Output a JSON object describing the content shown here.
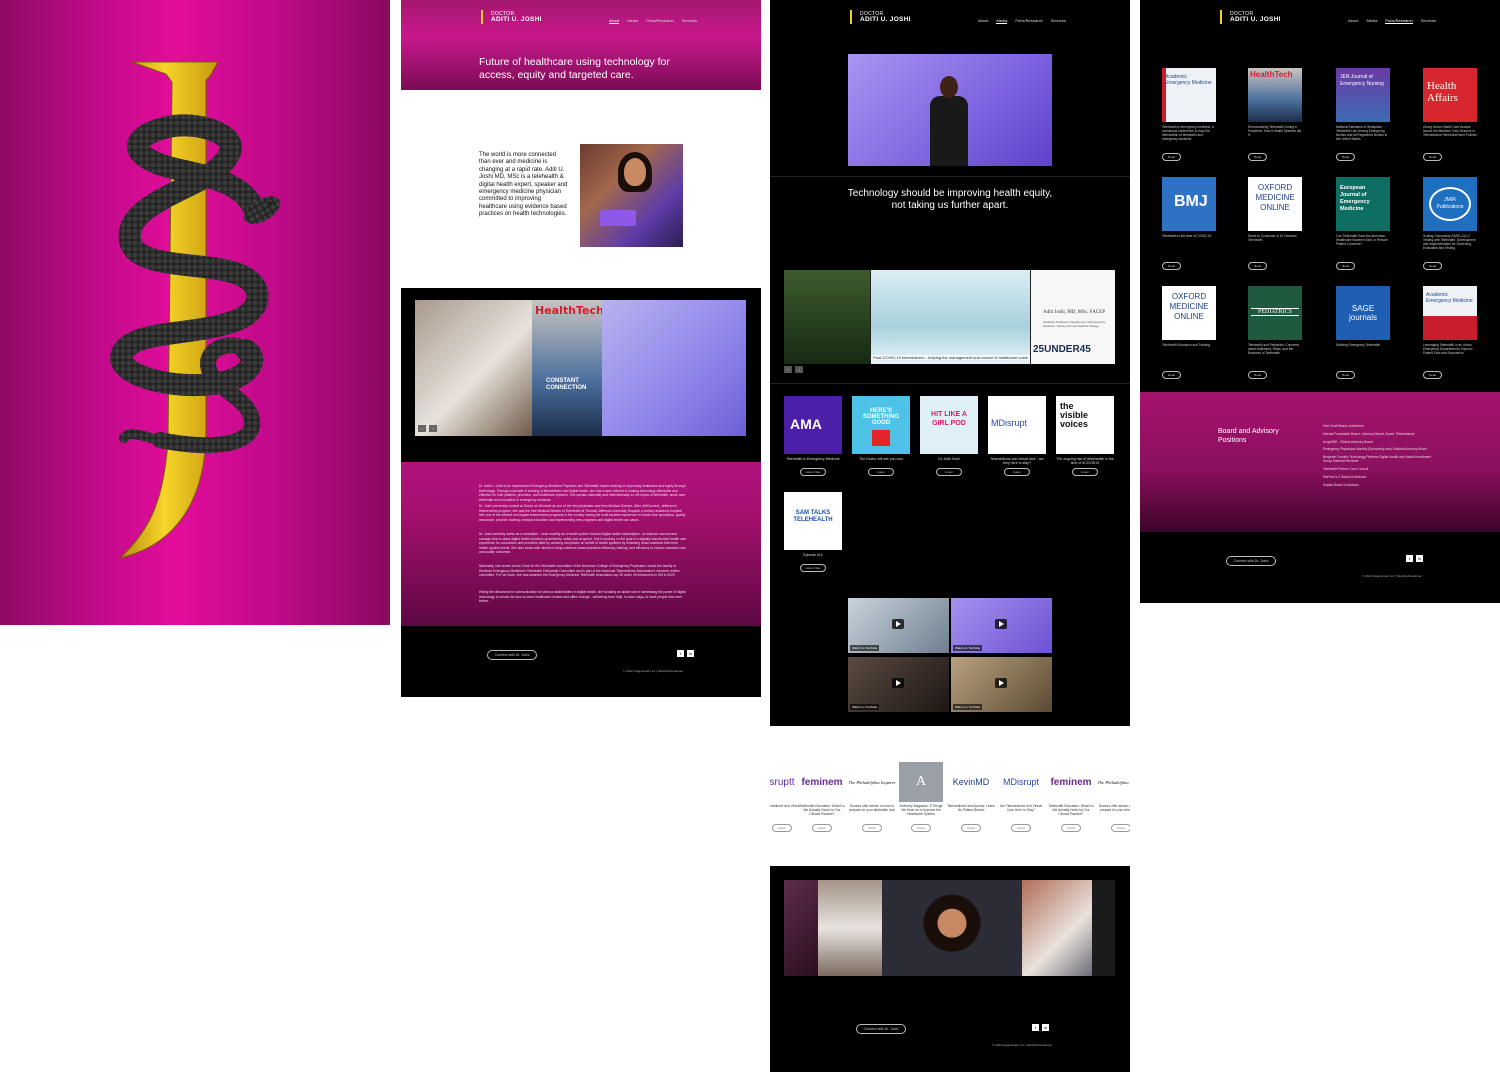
{
  "colors": {
    "magenta": "#c10a8a",
    "gold": "#f3c81b",
    "black": "#000000",
    "snake": "#2b2b2b"
  },
  "logo": {
    "icon": "rod-of-asclepius-icon"
  },
  "nav": {
    "brand_small": "DOCTOR",
    "brand_name": "ADITI U. JOSHI",
    "links": [
      "About",
      "Media",
      "Pubs/Research",
      "Services"
    ]
  },
  "about": {
    "headline": "Future of healthcare using technology for access, equity and targeted care.",
    "bio": "The world is more connected than ever and medicine is changing at a rapid rate. Aditi U. Joshi MD, MSc is a telehealth & digital health expert, speaker and emergency medicine physician committed to improving healthcare using evidence based practices on health technologies.",
    "gallery_magazine": "HealthTech",
    "gallery_cover_line": "CONSTANT CONNECTION",
    "paragraphs": [
      "Dr. Aditi U. Joshi is an experienced Emergency Medicine Physician and Telehealth expert working on improving healthcare and equity through technology. Through a decade of working in telemedicine and digital health, she has a keen interest in making technology affordable and effective for both patients, providers, and healthcare systems. She speaks nationally and internationally on the topics of telehealth, acute care telehealth and innovation in emergency medicine.",
      "Dr. Joshi previously worked at Doctor on Demand as one of the first physicians and then Medical Director. After JeffConnect, Jefferson's telemedicine program, she was the first Medical Director of Telehealth at Thomas Jefferson University Hospital, a tertiary academic hospital with one of the earliest and largest telemedicine programs in the country having the multi-faceted experience in virtual care operations, quality assurance, provider training, medical education and implementing new programs and digital health use cases.",
      "Dr. Joshi currently works as a consultant - most recently as a health system focused digital health marketplace - to improve connect and manage best-in-class digital health solutions prominently, safely and at speed. She is working on the goal of a digitally transformed health care experience for consumers and providers alike by advising companies on behalf of health systems by reviewing smart solutions that meet health system needs. She also works with clients to bring evidence based practices efficiency, training, and efficiency to ensure educated care and quality outcomes.",
      "Nationally, she serves as the Chair for the Telehealth committee of the American College of Emergency Physicians, chairs the faculty of Students Emergency Medicine's Telehealth Fellowship Committee and is part of the American Telemedicine Association's research review committee. For her work, she was awarded the Emergency Medicine Telehealth Association top 25 under 45 influencers in EM in 2020.",
      "Hitting the disconnect in communication for various stakeholders in digital health, she is taking an active role in harnessing the power of digital technology to unlock the door to more healthcare choices and affect change - delivering more help, in more ways, to more people than ever before."
    ],
    "connect_label": "Connect with Dr. Joshi",
    "copyright": "© 2022 Flagpointed LLC | Medical Disclaimer"
  },
  "media": {
    "quote": "Technology should be improving health equity, not taking us further apart.",
    "strip_caption": "Post-COVID-19 telemedicine - helping the management and control of healthcare costs",
    "strip_name": "Aditi Joshi, MD, MSc, FACEP",
    "strip_title": "Assistant Professor, Department of Emergency Medicine, Sidney Kimmel Medical College",
    "strip_award": "25UNDER45",
    "podcasts": [
      {
        "tile": "AMA",
        "caption": "Telehealth in Emergency Medicine",
        "button": "Listen Now"
      },
      {
        "tile": "HERE'S SOMETHING GOOD",
        "caption": "The Doctor will see you now",
        "button": "Listen"
      },
      {
        "tile": "HIT LIKE A GIRL POD",
        "caption": "Dr. Aditi Joshi",
        "button": "Listen"
      },
      {
        "tile": "MDisrupt",
        "caption": "Telemedicine and virtual care - are they here to stay?",
        "button": "Listen"
      },
      {
        "tile": "the visible voices",
        "caption": "The ongoing rise of #telehealth in the time of #COVID19",
        "button": "Listen"
      },
      {
        "tile": "SAM TALKS TELEHEALTH",
        "caption": "Episode #12",
        "button": "Listen Now"
      }
    ],
    "videos": [
      "Watch on YouTube",
      "Watch on YouTube",
      "Watch on YouTube",
      "Watch on YouTube"
    ],
    "press": [
      {
        "logo": "sruptt",
        "caption": "Telemedicine and Virtual",
        "button": "Read"
      },
      {
        "logo": "feminem",
        "caption": "Telehealth Education: What Do We Actually Need for Our Clinical Practice?",
        "button": "Read"
      },
      {
        "logo": "The Philadelphia Inquirer",
        "caption": "Doctors offer advice on how to prepare for your telehealth visit",
        "button": "Read"
      },
      {
        "logo": "A",
        "caption": "Authority Magazine: 5 Things We Must do to Improve the Healthcare System",
        "button": "Read"
      },
      {
        "logo": "KevinMD",
        "caption": "Telemedicine and Access: Leave No Patient Behind",
        "button": "Read"
      },
      {
        "logo": "MDisrupt",
        "caption": "Are Telemedicine and Virtual Care Here to Stay?",
        "button": "Read"
      },
      {
        "logo": "feminem",
        "caption": "Telehealth Education: What Do We Actually Need for Our Clinical Practice?",
        "button": "Read"
      },
      {
        "logo": "The Philadelphia Inquirer",
        "caption": "Doctors offer advice on how to prepare for your telehealth vi",
        "button": "Read"
      }
    ],
    "connect_label": "Connect with Dr. Joshi",
    "copyright": "© 2022 Flagpointed LLC | Medical Disclaimer"
  },
  "research": {
    "pubs": [
      {
        "cover": "Academic Emergency Medicine",
        "caption": "Telehealth in emergency medicine: A consensus conference to map the intersection of telehealth and emergency medicine",
        "button": "Read"
      },
      {
        "cover": "HealthTech",
        "caption": "Democratizing Telehealth During a Pandemic: How it Health Systems did it",
        "button": "Read"
      },
      {
        "cover": "JEN Journal of Emergency Nursing",
        "caption": "National Estimates of Workplace Telehealth Use Among Emergency Nurses and All Registered Nurses in the United States",
        "button": "Read"
      },
      {
        "cover": "Health Affairs",
        "caption": "Giving Urban Health Care Access Issues the Attention They Deserve in Telemedicine Reimbursement Policies",
        "button": "Read"
      },
      {
        "cover": "BMJ",
        "caption": "Telehealth in the time of COVID-19",
        "button": "Read"
      },
      {
        "cover": "OXFORD MEDICINE ONLINE",
        "caption": "Direct to Consumer or Dr Demand Telehealth",
        "button": "Read"
      },
      {
        "cover": "European Journal of Emergency Medicine",
        "caption": "Can Telehealth Ease the American Healthcare System's Mon or Reduce Patient Concerns?",
        "button": "Read"
      },
      {
        "cover": "JMIR Publications",
        "caption": "Scaling Community SARS-CoV-2 Testing with Telehealth: Development and Implementation for Screening, Evaluation and Testing",
        "button": "Read"
      },
      {
        "cover": "OXFORD MEDICINE ONLINE",
        "caption": "Telehealth Education and Training",
        "button": "Read"
      },
      {
        "cover": "PEDIATRICS",
        "caption": "Telehealth and Pediatrics: Concerns about Antibiotics, Risks, and the Business of Telehealth",
        "button": "Read"
      },
      {
        "cover": "SAGE journals",
        "caption": "Defining Emergency Telehealth",
        "button": "Read"
      },
      {
        "cover": "Academic Emergency Medicine",
        "caption": "Leveraging Telehealth in an Urban Emergency Department to Improve Patient Flow and Experience",
        "button": "Read"
      }
    ],
    "board_title": "Board and Advisory Positions",
    "board_items": [
      "Vice Chair Board of Advisors",
      "Mavida Foundation Board - Advisory Board, Board, Telemedicine",
      "Acquit360 - Clinical Advisory Board",
      "Emergency Physicians Monthly (Epmonthly.com) Editorial Advisory Board",
      "Benjamin Franklin Technology Partners Digital Health and Health Investment Group External Reviewer",
      "Telehealth Partner Care Council",
      "MoFirst LLC Board of Advisors",
      "Sopaid Board of Advisors"
    ],
    "connect_label": "Connect with Dr. Joshi",
    "copyright": "© 2022 Flagpointed LLC | Medical Disclaimer"
  }
}
